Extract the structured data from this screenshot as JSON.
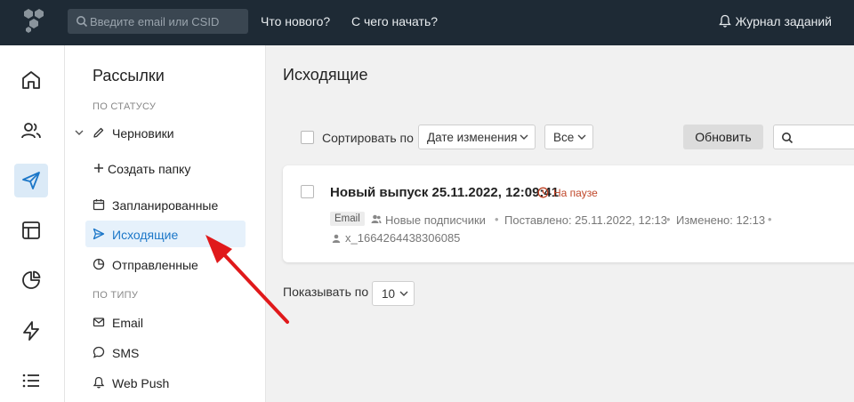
{
  "topbar": {
    "search_placeholder": "Введите email или CSID",
    "links": [
      "Что нового?",
      "С чего начать?"
    ],
    "journal": "Журнал заданий"
  },
  "sidebar": {
    "title": "Рассылки",
    "section_status": "ПО СТАТУСУ",
    "drafts": "Черновики",
    "create_folder": "Создать папку",
    "scheduled": "Запланированные",
    "outgoing": "Исходящие",
    "sent": "Отправленные",
    "section_type": "ПО ТИПУ",
    "email": "Email",
    "sms": "SMS",
    "webpush": "Web Push"
  },
  "main": {
    "title": "Исходящие",
    "sort_label": "Сортировать по",
    "sort_value": "Дате изменения",
    "filter_value": "Все",
    "refresh": "Обновить",
    "per_page_label": "Показывать по",
    "per_page_value": "10"
  },
  "item": {
    "title": "Новый выпуск 25.11.2022, 12:09:41",
    "status": "На паузе",
    "tag": "Email",
    "audience": "Новые подписчики",
    "queued": "Поставлено: 25.11.2022, 12:13",
    "changed": "Изменено: 12:13",
    "author": "x_1664264438306085"
  },
  "colors": {
    "topbar": "#1e2a35",
    "accent": "#1c77c8",
    "pause": "#c0472a",
    "arrow": "#e0191b"
  }
}
